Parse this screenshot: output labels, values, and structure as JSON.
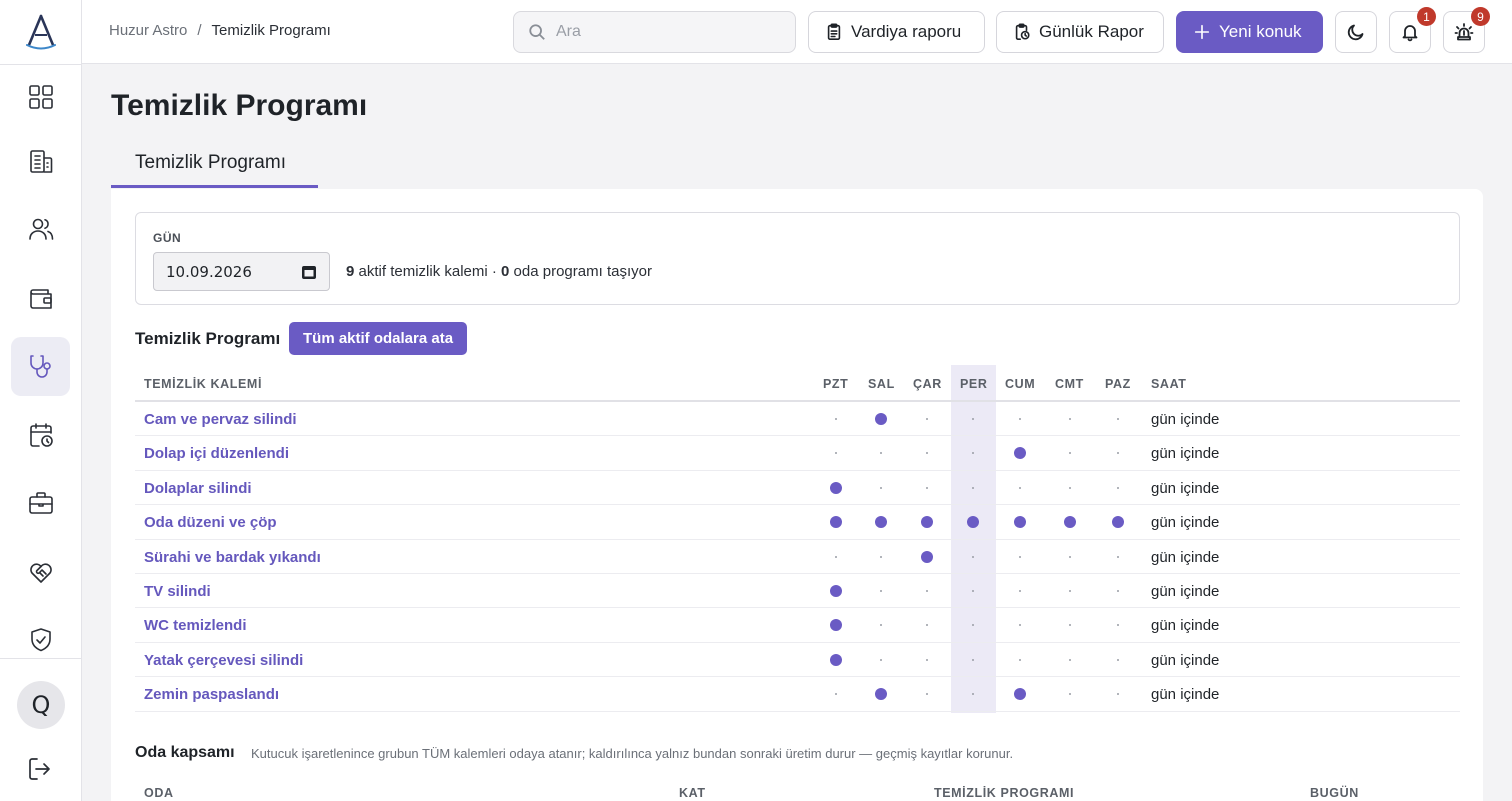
{
  "app": {
    "name": "Huzur Astro"
  },
  "header": {
    "breadcrumb_root": "Huzur Astro",
    "breadcrumb_sep": "/",
    "breadcrumb_current": "Temizlik Programı",
    "search_placeholder": "Ara",
    "shift_report": "Vardiya raporu",
    "daily_report": "Günlük Rapor",
    "new_guest": "Yeni konuk",
    "notifications_count": "1",
    "alarms_count": "9"
  },
  "sidebar": {
    "avatar_letter": "Q"
  },
  "page": {
    "title": "Temizlik Programı",
    "tab": "Temizlik Programı"
  },
  "filter": {
    "label": "GÜN",
    "date": "10.09.2026",
    "active_count": "9",
    "active_text": " aktif temizlik kalemi · ",
    "room_count": "0",
    "room_text": " oda programı taşıyor"
  },
  "schedule": {
    "title": "Temizlik Programı",
    "assign_button": "Tüm aktif odalara ata",
    "columns": {
      "item": "TEMİZLİK KALEMİ",
      "days": [
        "PZT",
        "SAL",
        "ÇAR",
        "PER",
        "CUM",
        "CMT",
        "PAZ"
      ],
      "time": "SAAT"
    },
    "today_index": 3,
    "rows": [
      {
        "name": "Cam ve pervaz silindi",
        "days": [
          0,
          1,
          0,
          0,
          0,
          0,
          0
        ],
        "time": "gün içinde"
      },
      {
        "name": "Dolap içi düzenlendi",
        "days": [
          0,
          0,
          0,
          0,
          1,
          0,
          0
        ],
        "time": "gün içinde"
      },
      {
        "name": "Dolaplar silindi",
        "days": [
          1,
          0,
          0,
          0,
          0,
          0,
          0
        ],
        "time": "gün içinde"
      },
      {
        "name": "Oda düzeni ve çöp",
        "days": [
          1,
          1,
          1,
          1,
          1,
          1,
          1
        ],
        "time": "gün içinde"
      },
      {
        "name": "Sürahi ve bardak yıkandı",
        "days": [
          0,
          0,
          1,
          0,
          0,
          0,
          0
        ],
        "time": "gün içinde"
      },
      {
        "name": "TV silindi",
        "days": [
          1,
          0,
          0,
          0,
          0,
          0,
          0
        ],
        "time": "gün içinde"
      },
      {
        "name": "WC temizlendi",
        "days": [
          1,
          0,
          0,
          0,
          0,
          0,
          0
        ],
        "time": "gün içinde"
      },
      {
        "name": "Yatak çerçevesi silindi",
        "days": [
          1,
          0,
          0,
          0,
          0,
          0,
          0
        ],
        "time": "gün içinde"
      },
      {
        "name": "Zemin paspaslandı",
        "days": [
          0,
          1,
          0,
          0,
          1,
          0,
          0
        ],
        "time": "gün içinde"
      }
    ]
  },
  "coverage": {
    "title": "Oda kapsamı",
    "note": "Kutucuk işaretlenince grubun TÜM kalemleri odaya atanır; kaldırılınca yalnız bundan sonraki üretim durur — geçmiş kayıtlar korunur.",
    "columns": [
      "ODA",
      "KAT",
      "TEMİZLİK PROGRAMI",
      "BUGÜN"
    ]
  },
  "colors": {
    "accent": "#6a5bc4",
    "today_col": "#eceaf6",
    "badge": "#c0392b"
  }
}
